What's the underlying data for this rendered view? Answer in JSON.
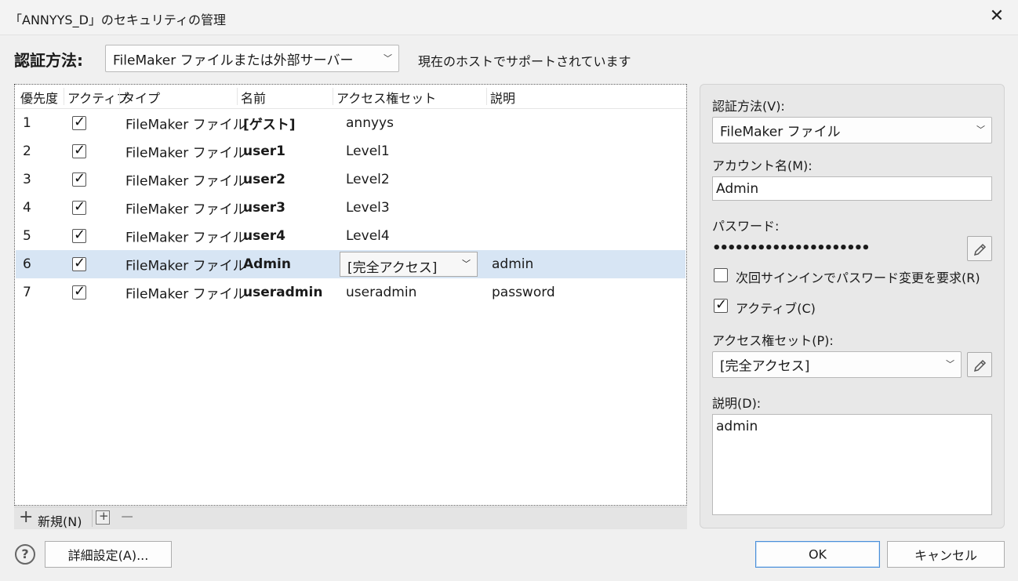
{
  "window": {
    "title": "「ANNYYS_D」のセキュリティの管理",
    "close_glyph": "✕"
  },
  "auth": {
    "label": "認証方法:",
    "selected": "FileMaker ファイルまたは外部サーバー",
    "note": "現在のホストでサポートされています"
  },
  "table": {
    "headers": [
      "優先度",
      "アクティブ",
      "タイプ",
      "名前",
      "アクセス権セット",
      "説明"
    ],
    "rows": [
      {
        "priority": "1",
        "active": true,
        "type": "FileMaker ファイル",
        "name": "[ゲスト]",
        "privilege": "annyys",
        "description": ""
      },
      {
        "priority": "2",
        "active": true,
        "type": "FileMaker ファイル",
        "name": "user1",
        "privilege": "Level1",
        "description": ""
      },
      {
        "priority": "3",
        "active": true,
        "type": "FileMaker ファイル",
        "name": "user2",
        "privilege": "Level2",
        "description": ""
      },
      {
        "priority": "4",
        "active": true,
        "type": "FileMaker ファイル",
        "name": "user3",
        "privilege": "Level3",
        "description": ""
      },
      {
        "priority": "5",
        "active": true,
        "type": "FileMaker ファイル",
        "name": "user4",
        "privilege": "Level4",
        "description": ""
      },
      {
        "priority": "6",
        "active": true,
        "type": "FileMaker ファイル",
        "name": "Admin",
        "privilege": "[完全アクセス]",
        "description": "admin",
        "selected": true
      },
      {
        "priority": "7",
        "active": true,
        "type": "FileMaker ファイル",
        "name": "useradmin",
        "privilege": "useradmin",
        "description": "password"
      }
    ]
  },
  "toolbar": {
    "new_plus": "+",
    "new_label": "新規(N)",
    "dup_plus": "+",
    "delete_glyph": "−"
  },
  "side": {
    "auth_label": "認証方法(V):",
    "auth_value": "FileMaker ファイル",
    "account_label": "アカウント名(M):",
    "account_value": "Admin",
    "password_label": "パスワード:",
    "password_mask": "•••••••••••••••••••••",
    "require_change_label": "次回サインインでパスワード変更を要求(R)",
    "require_change_checked": false,
    "active_label": "アクティブ(C)",
    "active_checked": true,
    "privilege_label": "アクセス権セット(P):",
    "privilege_value": "[完全アクセス]",
    "description_label": "説明(D):",
    "description_value": "admin"
  },
  "footer": {
    "help_glyph": "?",
    "advanced_label": "詳細設定(A)...",
    "ok_label": "OK",
    "cancel_label": "キャンセル"
  },
  "colors": {
    "selection": "#d7e5f4",
    "default_button_border": "#4a8fd9"
  },
  "icons": {
    "edit": "pencil-icon",
    "help": "question-circle-icon",
    "dropdown": "chevron-down-icon"
  }
}
